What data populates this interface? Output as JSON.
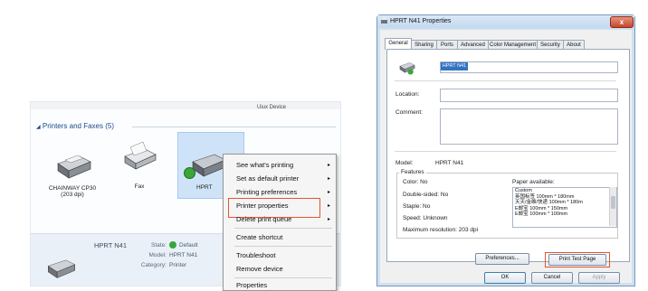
{
  "left": {
    "top_right_text": "Uiux Device",
    "section_header": "Printers and Faxes (5)",
    "printers": [
      {
        "name": "CHAINWAY CP30",
        "sub": "(203 dpi)"
      },
      {
        "name": "Fax",
        "sub": ""
      },
      {
        "name": "HPRT",
        "sub": ""
      }
    ],
    "details": {
      "name": "HPRT N41",
      "state_label": "State:",
      "state_value": "Default",
      "model_label": "Model:",
      "model_value": "HPRT N41",
      "category_label": "Category:",
      "category_value": "Printer"
    },
    "context_menu": [
      {
        "label": "See what's printing",
        "arrow": "▸"
      },
      {
        "label": "Set as default printer",
        "arrow": "▸"
      },
      {
        "label": "Printing preferences",
        "arrow": "▸"
      },
      {
        "label": "Printer properties",
        "arrow": "▸"
      },
      {
        "label": "Delete print queue",
        "arrow": "▸"
      },
      {
        "label": "Create shortcut",
        "arrow": ""
      },
      {
        "label": "Troubleshoot",
        "arrow": ""
      },
      {
        "label": "Remove device",
        "arrow": ""
      },
      {
        "label": "Properties",
        "arrow": ""
      }
    ]
  },
  "dialog": {
    "title": "HPRT N41 Properties",
    "close_symbol": "x",
    "tabs": [
      "General",
      "Sharing",
      "Ports",
      "Advanced",
      "Color Management",
      "Security",
      "About"
    ],
    "printer_name_value": "HPRT N41",
    "location_label": "Location:",
    "comment_label": "Comment:",
    "model_label": "Model:",
    "model_value": "HPRT N41",
    "features_title": "Features",
    "color_label": "Color: No",
    "double_sided_label": "Double-sided: No",
    "staple_label": "Staple: No",
    "speed_label": "Speed: Unknown",
    "max_res_label": "Maximum resolution: 203 dpi",
    "paper_available_label": "Paper available:",
    "paper_list": [
      "Custom",
      "英国标签 100mm * 180mm",
      "天天/金维/快递 100mm * 180m",
      "E邮宝 100mm * 150mm",
      "E邮宝 100mm * 100mm"
    ],
    "preferences_button": "Preferences...",
    "print_test_button": "Print Test Page",
    "ok_button": "OK",
    "cancel_button": "Cancel",
    "apply_button": "Apply"
  },
  "colors": {
    "highlight": "#e05535",
    "selection": "#3373c4",
    "header_blue": "#1b4b8f"
  }
}
